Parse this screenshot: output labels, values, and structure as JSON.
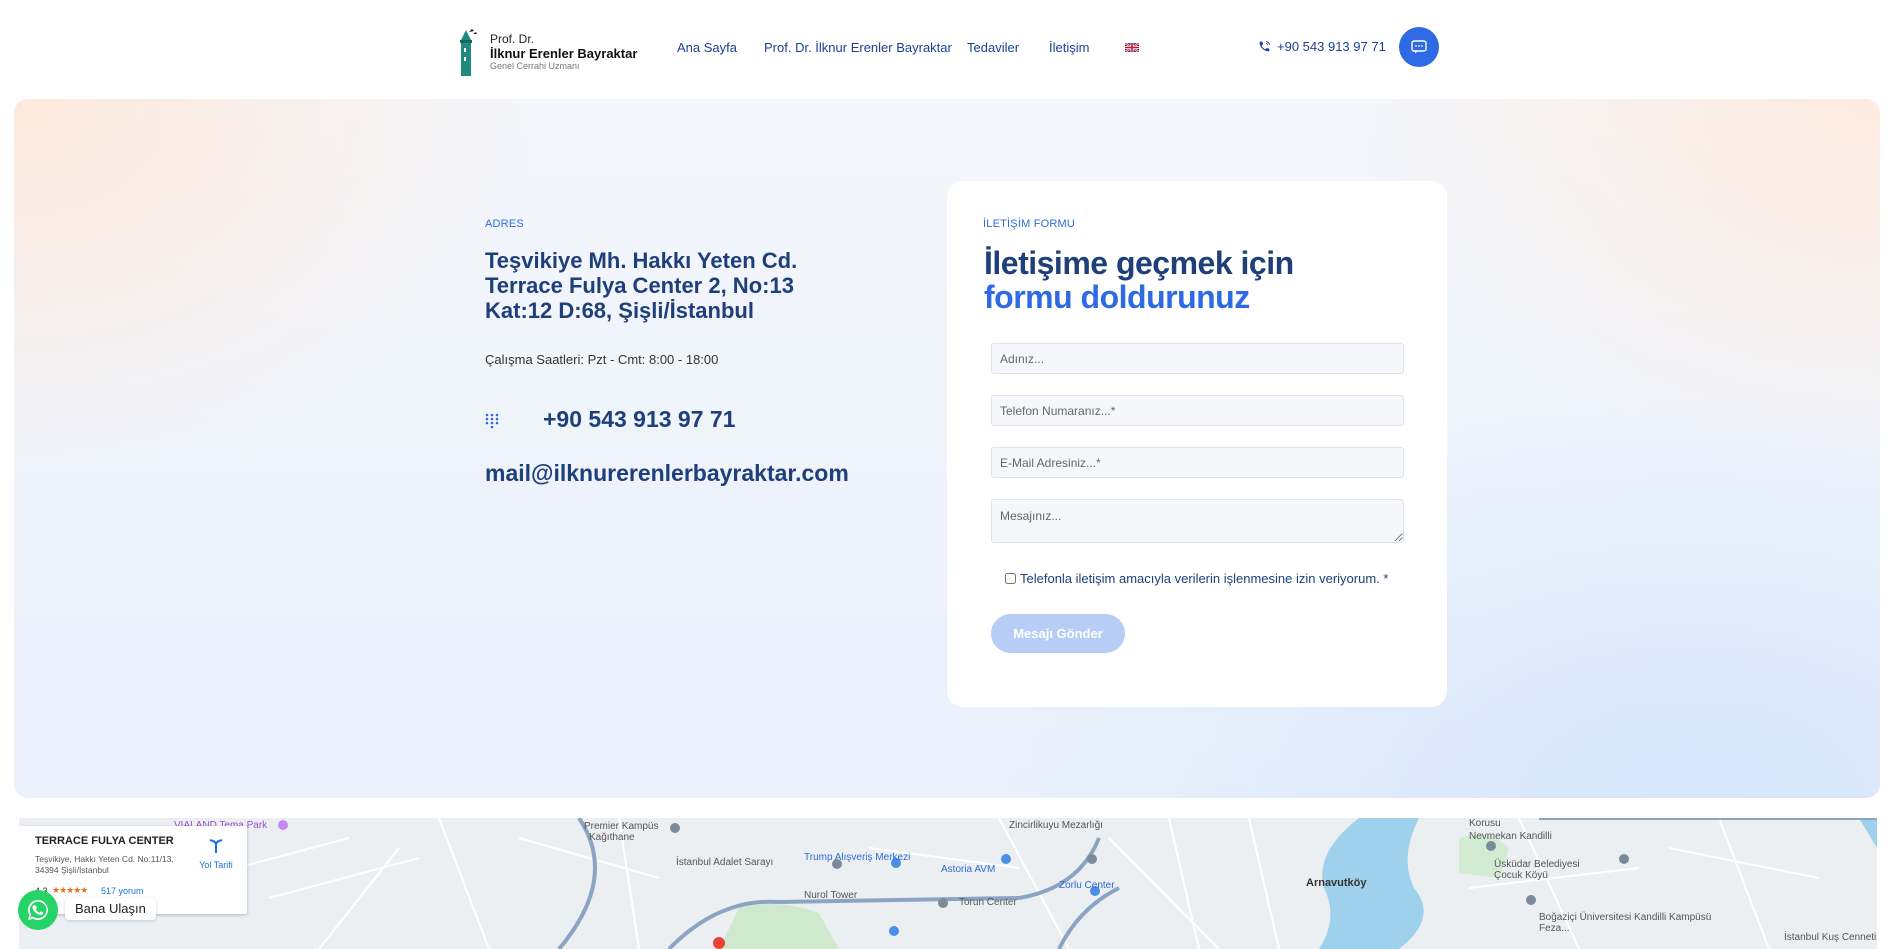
{
  "header": {
    "logo": {
      "line1": "Prof. Dr.",
      "line2": "İlknur Erenler Bayraktar",
      "line3": "Genel Cerrahi Uzmanı"
    },
    "nav": [
      {
        "label": "Ana Sayfa"
      },
      {
        "label": "Prof. Dr. İlknur Erenler Bayraktar"
      },
      {
        "label": "Tedaviler"
      },
      {
        "label": "İletişim"
      }
    ],
    "language_flag": "uk-flag-icon",
    "phone": "+90 543 913 97 71",
    "chat_icon": "chat-bubble-icon"
  },
  "contact": {
    "address_label": "ADRES",
    "address": "Teşvikiye Mh. Hakkı Yeten Cd. Terrace Fulya Center 2, No:13 Kat:12 D:68, Şişli/İstanbul",
    "hours": "Çalışma Saatleri: Pzt - Cmt: 8:00 - 18:00",
    "phone": "+90 543 913 97 71",
    "email": "mail@ilknurerenlerbayraktar.com"
  },
  "form": {
    "label": "İLETİŞİM FORMU",
    "title_line1": "İletişime geçmek için",
    "title_line2": "formu doldurunuz",
    "name_placeholder": "Adınız...",
    "phone_placeholder": "Telefon Numaranız...*",
    "email_placeholder": "E-Mail Adresiniz...*",
    "message_placeholder": "Mesajınız...",
    "consent": "Telefonla iletişim amacıyla verilerin işlenmesine izin veriyorum. *",
    "submit": "Mesajı Gönder"
  },
  "map": {
    "place_card": {
      "title": "TERRACE FULYA CENTER",
      "address": "Teşvikiye, Hakkı Yeten Cd. No:11/13, 34394 Şişli/İstanbul",
      "rating": "4,3",
      "stars": "★★★★★",
      "reviews": "517 yorum",
      "directions": "Yol Tarifi"
    },
    "labels": [
      "VIALAND Tema Park",
      "Premier Kampüs",
      "Kağıthane",
      "İstanbul Adalet Sarayı",
      "Trump Alışveriş Merkezi",
      "Nurol Tower",
      "Astoria AVM",
      "Torun Center",
      "Zorlu Center",
      "Zincirlikuyu Mezarlığı",
      "Arnavutköy",
      "Korusu",
      "Nevmekan Kandilli",
      "Üsküdar Belediyesi Çocuk Köyü",
      "Boğaziçi Üniversitesi Kandilli Kampüsü Feza...",
      "İstanbul Kuş Cenneti"
    ],
    "colors": {
      "land": "#eceff2",
      "water": "#9fd0ec",
      "road": "#ffffff",
      "highway": "#8ca4c4"
    }
  },
  "whatsapp": {
    "label": "Bana Ulaşın",
    "icon": "whatsapp-icon"
  },
  "colors": {
    "primary": "#2d6ae3",
    "navy": "#1e3f7a",
    "button_disabled": "#b7cdf5"
  }
}
